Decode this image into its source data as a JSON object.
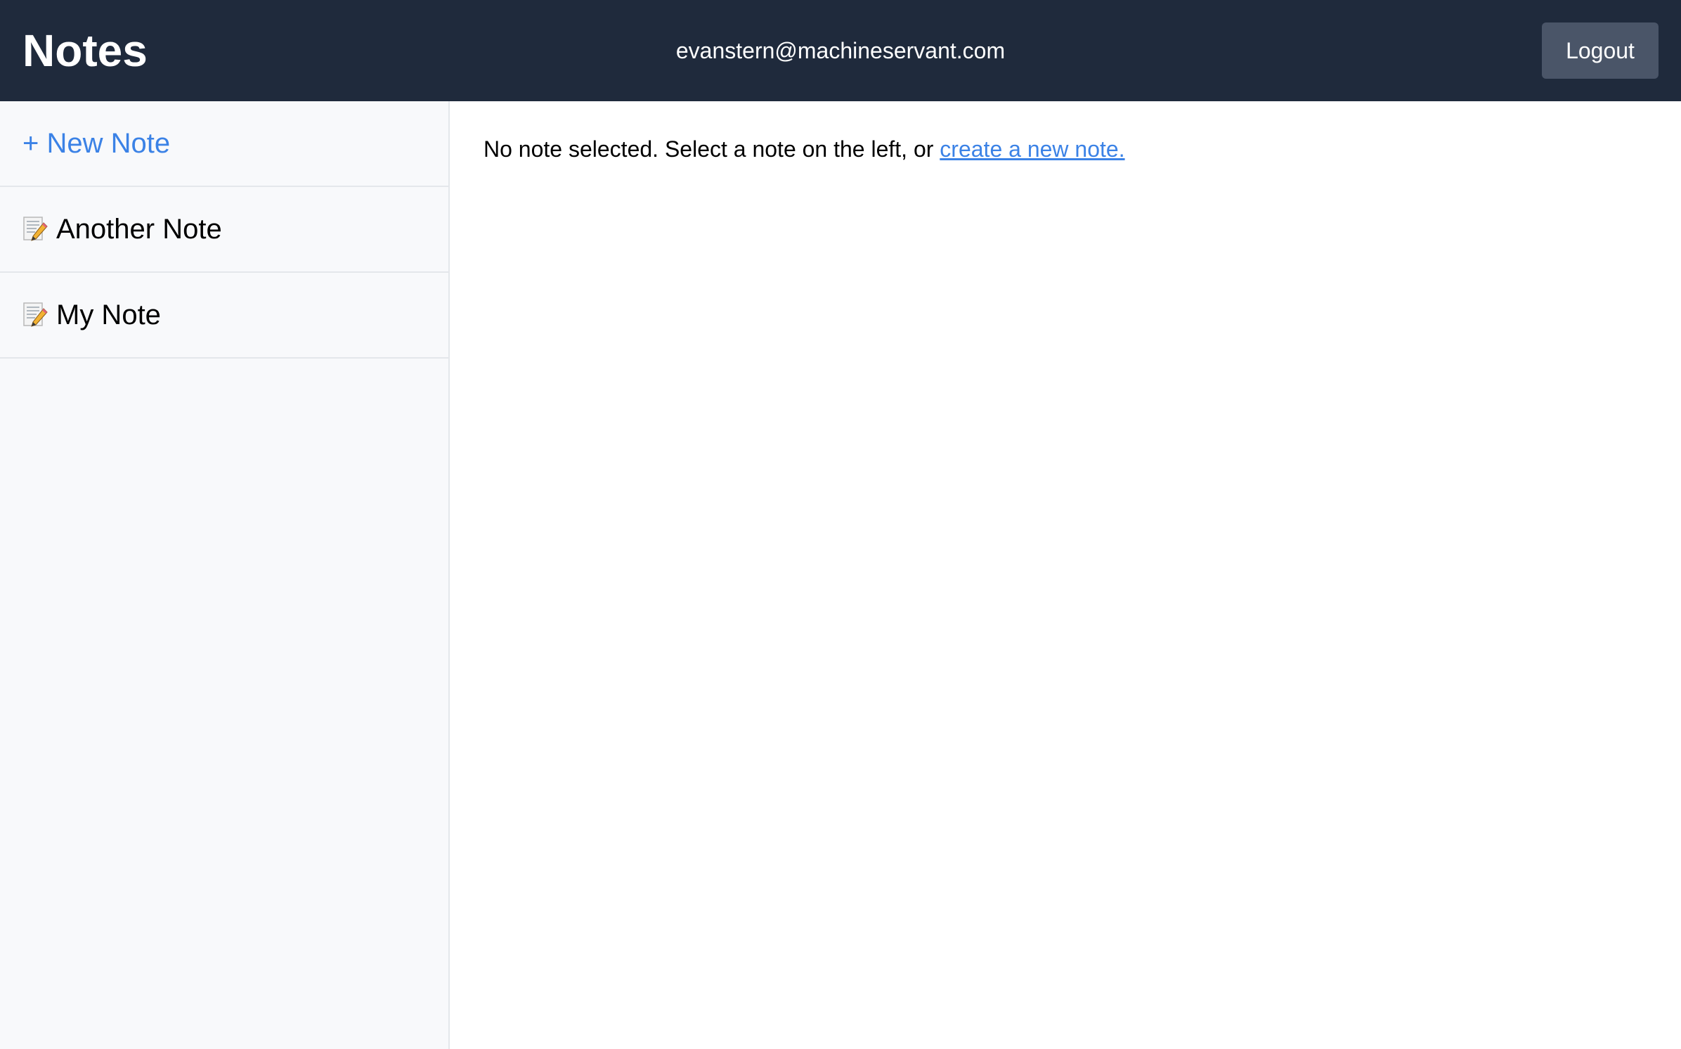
{
  "header": {
    "title": "Notes",
    "user_email": "evanstern@machineservant.com",
    "logout_label": "Logout"
  },
  "sidebar": {
    "new_note_label": "+ New Note",
    "notes": [
      {
        "icon": "memo-icon",
        "title": "Another Note"
      },
      {
        "icon": "memo-icon",
        "title": "My Note"
      }
    ]
  },
  "main": {
    "empty_message": "No note selected. Select a note on the left, or ",
    "create_link_label": "create a new note."
  },
  "colors": {
    "header_bg": "#1f2a3c",
    "accent": "#3b82e6",
    "logout_bg": "#4a5568",
    "sidebar_bg": "#f8f9fb"
  }
}
